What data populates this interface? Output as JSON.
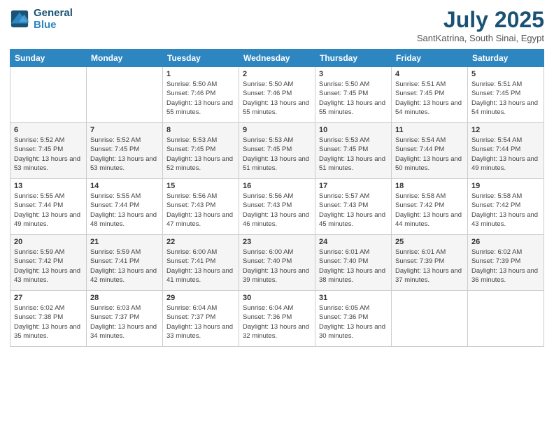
{
  "logo": {
    "line1": "General",
    "line2": "Blue"
  },
  "title": "July 2025",
  "subtitle": "SantKatrina, South Sinai, Egypt",
  "days_header": [
    "Sunday",
    "Monday",
    "Tuesday",
    "Wednesday",
    "Thursday",
    "Friday",
    "Saturday"
  ],
  "weeks": [
    [
      {
        "day": "",
        "info": ""
      },
      {
        "day": "",
        "info": ""
      },
      {
        "day": "1",
        "info": "Sunrise: 5:50 AM\nSunset: 7:46 PM\nDaylight: 13 hours and 55 minutes."
      },
      {
        "day": "2",
        "info": "Sunrise: 5:50 AM\nSunset: 7:46 PM\nDaylight: 13 hours and 55 minutes."
      },
      {
        "day": "3",
        "info": "Sunrise: 5:50 AM\nSunset: 7:45 PM\nDaylight: 13 hours and 55 minutes."
      },
      {
        "day": "4",
        "info": "Sunrise: 5:51 AM\nSunset: 7:45 PM\nDaylight: 13 hours and 54 minutes."
      },
      {
        "day": "5",
        "info": "Sunrise: 5:51 AM\nSunset: 7:45 PM\nDaylight: 13 hours and 54 minutes."
      }
    ],
    [
      {
        "day": "6",
        "info": "Sunrise: 5:52 AM\nSunset: 7:45 PM\nDaylight: 13 hours and 53 minutes."
      },
      {
        "day": "7",
        "info": "Sunrise: 5:52 AM\nSunset: 7:45 PM\nDaylight: 13 hours and 53 minutes."
      },
      {
        "day": "8",
        "info": "Sunrise: 5:53 AM\nSunset: 7:45 PM\nDaylight: 13 hours and 52 minutes."
      },
      {
        "day": "9",
        "info": "Sunrise: 5:53 AM\nSunset: 7:45 PM\nDaylight: 13 hours and 51 minutes."
      },
      {
        "day": "10",
        "info": "Sunrise: 5:53 AM\nSunset: 7:45 PM\nDaylight: 13 hours and 51 minutes."
      },
      {
        "day": "11",
        "info": "Sunrise: 5:54 AM\nSunset: 7:44 PM\nDaylight: 13 hours and 50 minutes."
      },
      {
        "day": "12",
        "info": "Sunrise: 5:54 AM\nSunset: 7:44 PM\nDaylight: 13 hours and 49 minutes."
      }
    ],
    [
      {
        "day": "13",
        "info": "Sunrise: 5:55 AM\nSunset: 7:44 PM\nDaylight: 13 hours and 49 minutes."
      },
      {
        "day": "14",
        "info": "Sunrise: 5:55 AM\nSunset: 7:44 PM\nDaylight: 13 hours and 48 minutes."
      },
      {
        "day": "15",
        "info": "Sunrise: 5:56 AM\nSunset: 7:43 PM\nDaylight: 13 hours and 47 minutes."
      },
      {
        "day": "16",
        "info": "Sunrise: 5:56 AM\nSunset: 7:43 PM\nDaylight: 13 hours and 46 minutes."
      },
      {
        "day": "17",
        "info": "Sunrise: 5:57 AM\nSunset: 7:43 PM\nDaylight: 13 hours and 45 minutes."
      },
      {
        "day": "18",
        "info": "Sunrise: 5:58 AM\nSunset: 7:42 PM\nDaylight: 13 hours and 44 minutes."
      },
      {
        "day": "19",
        "info": "Sunrise: 5:58 AM\nSunset: 7:42 PM\nDaylight: 13 hours and 43 minutes."
      }
    ],
    [
      {
        "day": "20",
        "info": "Sunrise: 5:59 AM\nSunset: 7:42 PM\nDaylight: 13 hours and 43 minutes."
      },
      {
        "day": "21",
        "info": "Sunrise: 5:59 AM\nSunset: 7:41 PM\nDaylight: 13 hours and 42 minutes."
      },
      {
        "day": "22",
        "info": "Sunrise: 6:00 AM\nSunset: 7:41 PM\nDaylight: 13 hours and 41 minutes."
      },
      {
        "day": "23",
        "info": "Sunrise: 6:00 AM\nSunset: 7:40 PM\nDaylight: 13 hours and 39 minutes."
      },
      {
        "day": "24",
        "info": "Sunrise: 6:01 AM\nSunset: 7:40 PM\nDaylight: 13 hours and 38 minutes."
      },
      {
        "day": "25",
        "info": "Sunrise: 6:01 AM\nSunset: 7:39 PM\nDaylight: 13 hours and 37 minutes."
      },
      {
        "day": "26",
        "info": "Sunrise: 6:02 AM\nSunset: 7:39 PM\nDaylight: 13 hours and 36 minutes."
      }
    ],
    [
      {
        "day": "27",
        "info": "Sunrise: 6:02 AM\nSunset: 7:38 PM\nDaylight: 13 hours and 35 minutes."
      },
      {
        "day": "28",
        "info": "Sunrise: 6:03 AM\nSunset: 7:37 PM\nDaylight: 13 hours and 34 minutes."
      },
      {
        "day": "29",
        "info": "Sunrise: 6:04 AM\nSunset: 7:37 PM\nDaylight: 13 hours and 33 minutes."
      },
      {
        "day": "30",
        "info": "Sunrise: 6:04 AM\nSunset: 7:36 PM\nDaylight: 13 hours and 32 minutes."
      },
      {
        "day": "31",
        "info": "Sunrise: 6:05 AM\nSunset: 7:36 PM\nDaylight: 13 hours and 30 minutes."
      },
      {
        "day": "",
        "info": ""
      },
      {
        "day": "",
        "info": ""
      }
    ]
  ]
}
